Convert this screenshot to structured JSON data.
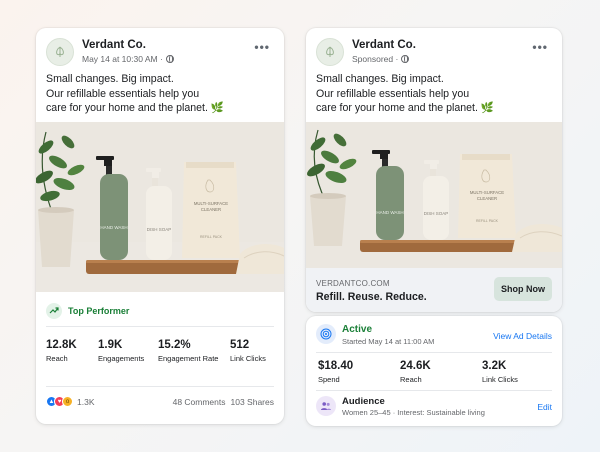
{
  "organic_post": {
    "brand": "Verdant Co.",
    "meta": "May 14 at 10:30 AM ·",
    "caption_lines": [
      "Small changes. Big impact.",
      "Our refillable essentials help you",
      "care for your home and the planet."
    ],
    "caption_emoji": "🌿",
    "photo": {
      "bottle1_label": "HAND WASH",
      "bottle2_label": "DISH SOAP",
      "pouch_title_1": "MULTI-SURFACE",
      "pouch_title_2": "CLEANER",
      "pouch_sub_1": "REFILL PACK"
    },
    "badge": "Top Performer",
    "stats": [
      {
        "value": "12.8K",
        "label": "Reach"
      },
      {
        "value": "1.9K",
        "label": "Engagements"
      },
      {
        "value": "15.2%",
        "label": "Engagement Rate"
      },
      {
        "value": "512",
        "label": "Link Clicks"
      }
    ],
    "reaction_count": "1.3K",
    "comments": "48 Comments",
    "shares": "103 Shares"
  },
  "sponsored_post": {
    "brand": "Verdant Co.",
    "meta": "Sponsored ·",
    "caption_lines": [
      "Small changes. Big impact.",
      "Our refillable essentials help you",
      "care for your home and the planet."
    ],
    "caption_emoji": "🌿",
    "domain": "VERDANTCO.COM",
    "headline": "Refill. Reuse. Reduce.",
    "cta": "Shop Now"
  },
  "ad_status": {
    "status": "Active",
    "started": "Started May 14 at 11:00 AM",
    "view_link": "View Ad Details",
    "stats": [
      {
        "value": "$18.40",
        "label": "Spend"
      },
      {
        "value": "24.6K",
        "label": "Reach"
      },
      {
        "value": "3.2K",
        "label": "Link Clicks"
      }
    ],
    "audience_title": "Audience",
    "audience_desc": "Women 25–45 · Interest: Sustainable living",
    "edit": "Edit"
  },
  "colors": {
    "accent_blue": "#1877f2",
    "success_green": "#1a7f37",
    "bottle_sage": "#7d9277",
    "cta_bg": "#d7e4dd"
  }
}
